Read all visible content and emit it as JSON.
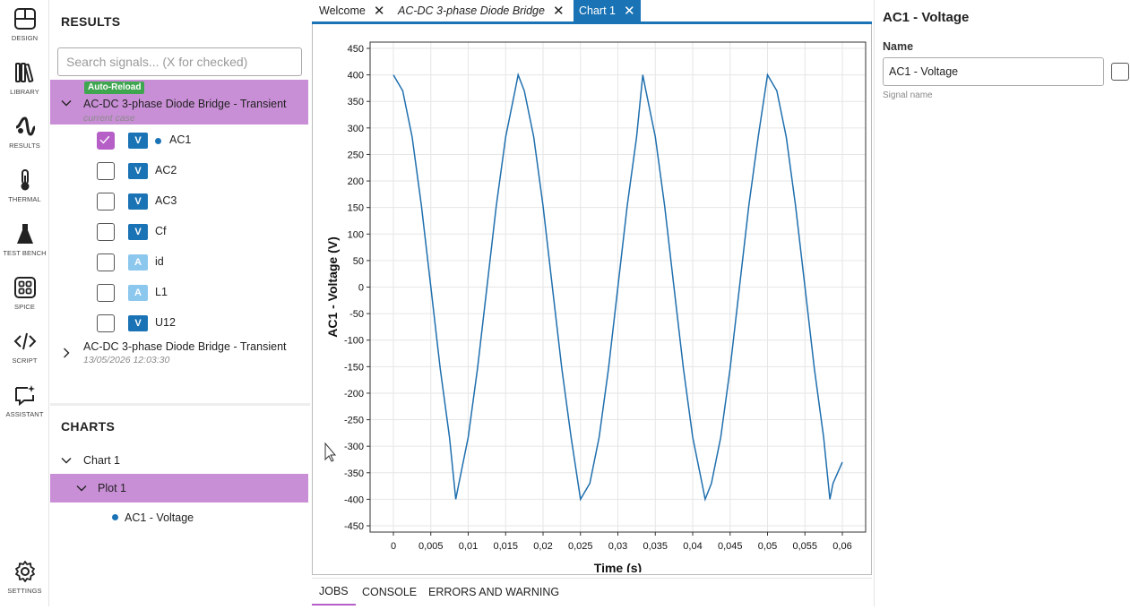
{
  "rail": [
    {
      "label": "DESIGN",
      "icon": "design-icon"
    },
    {
      "label": "LIBRARY",
      "icon": "library-icon"
    },
    {
      "label": "RESULTS",
      "icon": "results-icon"
    },
    {
      "label": "THERMAL",
      "icon": "thermometer-icon"
    },
    {
      "label": "TEST BENCH",
      "icon": "flask-icon"
    },
    {
      "label": "SPICE",
      "icon": "spice-icon"
    },
    {
      "label": "SCRIPT",
      "icon": "code-icon"
    },
    {
      "label": "ASSISTANT",
      "icon": "assistant-icon"
    },
    {
      "label": "SETTINGS",
      "icon": "gear-icon"
    }
  ],
  "results": {
    "title": "RESULTS",
    "search_placeholder": "Search signals... (X for checked)",
    "cases": [
      {
        "badge": "Auto-Reload",
        "title": "AC-DC 3-phase Diode Bridge - Transient",
        "subtitle": "current case",
        "expanded": true
      },
      {
        "title": "AC-DC 3-phase Diode Bridge - Transient",
        "subtitle": "13/05/2026 12:03:30",
        "expanded": false
      }
    ],
    "signals": [
      {
        "name": "AC1",
        "type": "V",
        "checked": true
      },
      {
        "name": "AC2",
        "type": "V",
        "checked": false
      },
      {
        "name": "AC3",
        "type": "V",
        "checked": false
      },
      {
        "name": "Cf",
        "type": "V",
        "checked": false
      },
      {
        "name": "id",
        "type": "A",
        "checked": false
      },
      {
        "name": "L1",
        "type": "A",
        "checked": false
      },
      {
        "name": "U12",
        "type": "V",
        "checked": false
      }
    ]
  },
  "charts": {
    "title": "CHARTS",
    "chart_name": "Chart 1",
    "plot_name": "Plot 1",
    "series_name": "AC1 - Voltage"
  },
  "tabs": [
    {
      "label": "Welcome",
      "italic": false,
      "active": false
    },
    {
      "label": "AC-DC 3-phase Diode Bridge",
      "italic": true,
      "active": false
    },
    {
      "label": "Chart 1",
      "italic": false,
      "active": true
    }
  ],
  "bottom_tabs": [
    {
      "label": "JOBS",
      "active": true
    },
    {
      "label": "CONSOLE",
      "active": false
    },
    {
      "label": "ERRORS AND WARNING",
      "active": false
    }
  ],
  "props": {
    "title": "AC1 - Voltage",
    "name_label": "Name",
    "name_value": "AC1 - Voltage",
    "hint": "Signal name"
  },
  "colors": {
    "accent": "#1a73b5",
    "selection": "#c98fd6",
    "checkbox_checked": "#b65fc7",
    "badge_green": "#3fa650",
    "series": "#1f6fae"
  },
  "chart_data": {
    "type": "line",
    "xlabel": "Time (s)",
    "ylabel": "AC1 - Voltage (V)",
    "xlim": [
      0,
      0.06
    ],
    "ylim": [
      -450,
      450
    ],
    "xticks": [
      "0",
      "0,005",
      "0,01",
      "0,015",
      "0,02",
      "0,025",
      "0,03",
      "0,035",
      "0,04",
      "0,045",
      "0,05",
      "0,055",
      "0,06"
    ],
    "yticks": [
      "450",
      "400",
      "350",
      "300",
      "250",
      "200",
      "150",
      "100",
      "50",
      "0",
      "-50",
      "-100",
      "-150",
      "-200",
      "-250",
      "-300",
      "-350",
      "-400",
      "-450"
    ],
    "grid": true,
    "series": [
      {
        "x": [
          0,
          0.00125,
          0.0025,
          0.00375,
          0.005,
          0.00625,
          0.0075,
          0.00833,
          0.00875,
          0.01,
          0.01125,
          0.0125,
          0.01375,
          0.015,
          0.01625,
          0.01667,
          0.0175,
          0.01875,
          0.02,
          0.02125,
          0.0225,
          0.02375,
          0.025,
          0.02625,
          0.0275,
          0.02875,
          0.03,
          0.03125,
          0.0325,
          0.03333,
          0.03375,
          0.035,
          0.03625,
          0.0375,
          0.03875,
          0.04,
          0.04125,
          0.04167,
          0.0425,
          0.04375,
          0.045,
          0.04625,
          0.0475,
          0.04875,
          0.05,
          0.05125,
          0.0525,
          0.05375,
          0.055,
          0.05625,
          0.0575,
          0.05833,
          0.05875,
          0.06
        ],
        "y": [
          400,
          370,
          283,
          153,
          0,
          -153,
          -283,
          -400,
          -370,
          -283,
          -153,
          0,
          153,
          283,
          370,
          400,
          370,
          283,
          153,
          0,
          -153,
          -283,
          -400,
          -370,
          -283,
          -153,
          0,
          153,
          283,
          400,
          370,
          283,
          153,
          0,
          -153,
          -283,
          -370,
          -400,
          -370,
          -283,
          -153,
          0,
          153,
          283,
          400,
          370,
          283,
          153,
          0,
          -153,
          -283,
          -400,
          -370,
          -330
        ]
      }
    ]
  }
}
